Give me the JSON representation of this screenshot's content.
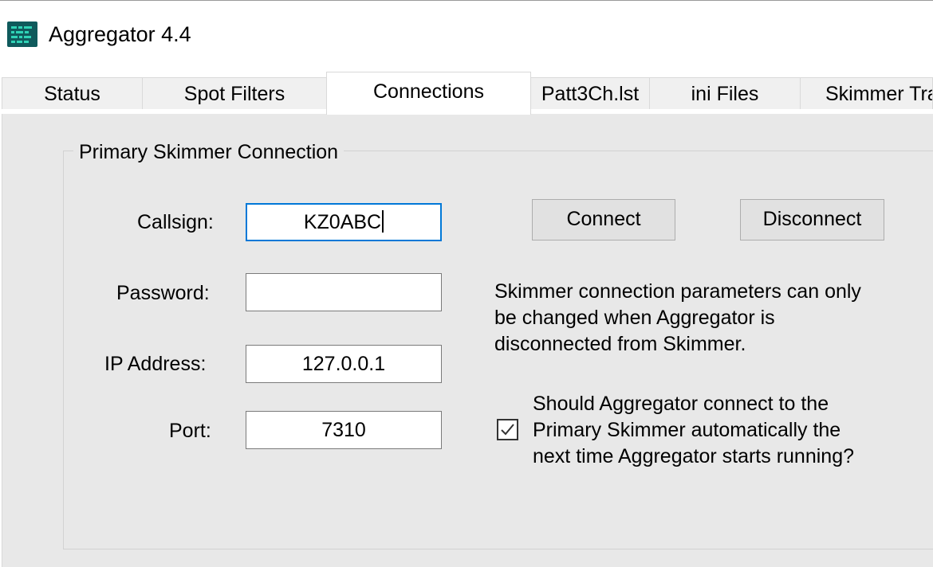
{
  "window": {
    "title": "Aggregator 4.4",
    "icon": "aggregator-app-icon"
  },
  "tabs": [
    {
      "label": "Status",
      "active": false
    },
    {
      "label": "Spot Filters",
      "active": false
    },
    {
      "label": "Connections",
      "active": true
    },
    {
      "label": "Patt3Ch.lst",
      "active": false
    },
    {
      "label": "ini Files",
      "active": false
    },
    {
      "label": "Skimmer Tra",
      "active": false
    }
  ],
  "connection": {
    "group_title": "Primary Skimmer Connection",
    "callsign_label": "Callsign:",
    "callsign_value": "KZ0ABC",
    "password_label": "Password:",
    "password_value": "",
    "ip_label": "IP Address:",
    "ip_value": "127.0.0.1",
    "port_label": "Port:",
    "port_value": "7310",
    "connect_label": "Connect",
    "disconnect_label": "Disconnect",
    "info_line1": "Skimmer connection parameters can only",
    "info_line2": "be changed when Aggregator is",
    "info_line3": "disconnected from Skimmer.",
    "autoconnect_line1": "Should Aggregator connect to the",
    "autoconnect_line2": "Primary Skimmer automatically the",
    "autoconnect_line3": "next time Aggregator starts running?",
    "autoconnect_checked": true
  },
  "colors": {
    "panel_bg": "#e8e8e8",
    "focus_border": "#0078d7",
    "icon_bg": "#0f5a5c",
    "icon_fg": "#2fd3b6"
  }
}
